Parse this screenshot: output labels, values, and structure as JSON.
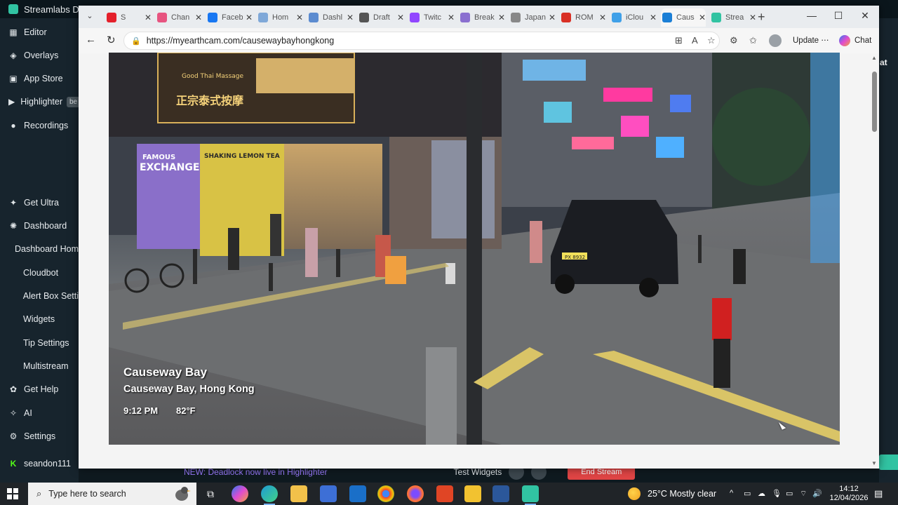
{
  "streamlabs": {
    "title": "Streamlabs De",
    "nav": [
      {
        "label": "Editor",
        "icon": "editor-icon"
      },
      {
        "label": "Overlays",
        "icon": "overlays-icon"
      },
      {
        "label": "App Store",
        "icon": "app-store-icon"
      },
      {
        "label": "Highlighter",
        "icon": "highlighter-icon",
        "badge": "be"
      },
      {
        "label": "Recordings",
        "icon": "recordings-icon"
      }
    ],
    "nav2": [
      {
        "label": "Get Ultra",
        "icon": "ultra-icon"
      },
      {
        "label": "Dashboard",
        "icon": "dashboard-icon"
      },
      {
        "label": "Dashboard Hom"
      },
      {
        "label": "Cloudbot"
      },
      {
        "label": "Alert Box Setti"
      },
      {
        "label": "Widgets"
      },
      {
        "label": "Tip Settings"
      },
      {
        "label": "Multistream"
      },
      {
        "label": "Get Help",
        "icon": "help-icon"
      },
      {
        "label": "AI",
        "icon": "ai-icon"
      },
      {
        "label": "Settings",
        "icon": "settings-icon"
      },
      {
        "label": "seandon111",
        "icon": "kick-icon"
      }
    ],
    "right_edge_text": "at",
    "bottom": {
      "news": "NEW: Deadlock now live in Highlighter",
      "test_widgets": "Test Widgets",
      "end_stream": "End Stream"
    }
  },
  "browser": {
    "tabs": [
      {
        "label": "S",
        "color": "#e4202b",
        "active": false
      },
      {
        "label": "Chan",
        "color": "#e75480",
        "active": false
      },
      {
        "label": "Faceb",
        "color": "#1877f2",
        "active": false
      },
      {
        "label": "Hom",
        "color": "#7fa8d8",
        "active": false
      },
      {
        "label": "Dashl",
        "color": "#5b8bd0",
        "active": false
      },
      {
        "label": "Draft",
        "color": "#555555",
        "active": false
      },
      {
        "label": "Twitc",
        "color": "#9146ff",
        "active": false
      },
      {
        "label": "Break",
        "color": "#8a6fd0",
        "active": false
      },
      {
        "label": "Japan",
        "color": "#888888",
        "active": false
      },
      {
        "label": "ROM",
        "color": "#d93025",
        "active": false
      },
      {
        "label": "iClou",
        "color": "#3fa0e8",
        "active": false
      },
      {
        "label": "Caus",
        "color": "#1b7fd6",
        "active": true
      },
      {
        "label": "Strea",
        "color": "#31c3a2",
        "active": false
      }
    ],
    "url": "https://myearthcam.com/causewaybayhongkong",
    "update_label": "Update",
    "chat_label": "Chat"
  },
  "video": {
    "title": "Causeway Bay",
    "subtitle": "Causeway Bay, Hong Kong",
    "time": "9:12 PM",
    "temperature": "82°F",
    "signs": {
      "massage_en": "Good Thai Massage",
      "massage_cn": "正宗泰式按摩",
      "exchange": "EXCHANGE",
      "famous": "FAMOUS",
      "lemon_tea": "SHAKING LEMON TEA",
      "number_plate": "PX 8932"
    }
  },
  "taskbar": {
    "search_placeholder": "Type here to search",
    "weather": "25°C  Mostly clear",
    "time": "14:12",
    "date": "12/04/2026"
  }
}
